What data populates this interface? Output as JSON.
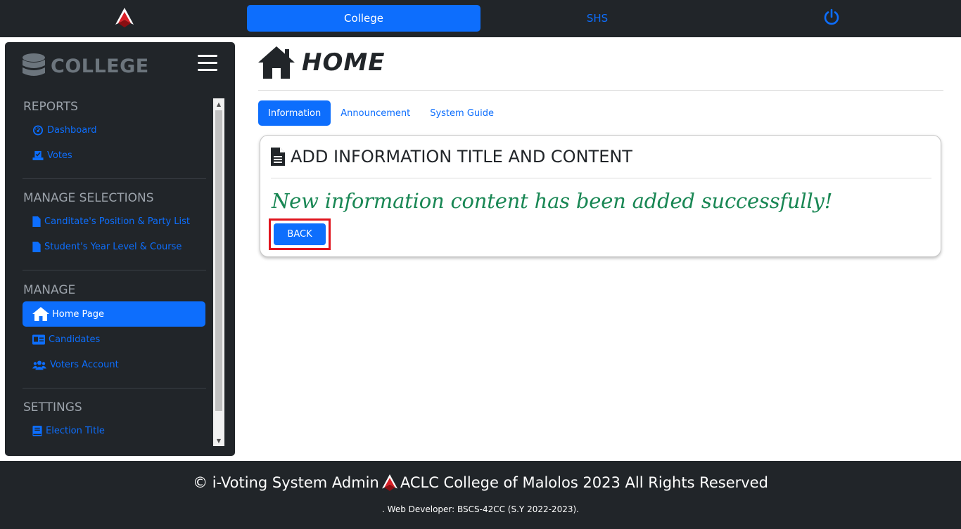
{
  "topnav": {
    "college_label": "College",
    "shs_label": "SHS"
  },
  "sidebar": {
    "brand": "COLLEGE",
    "sections": [
      {
        "title": "REPORTS",
        "items": [
          "Dashboard",
          "Votes"
        ]
      },
      {
        "title": "MANAGE SELECTIONS",
        "items": [
          "Canditate's Position & Party List",
          "Student's Year Level & Course"
        ]
      },
      {
        "title": "MANAGE",
        "items": [
          "Home Page",
          "Candidates",
          "Voters Account"
        ]
      },
      {
        "title": "SETTINGS",
        "items": [
          "Election Title"
        ]
      }
    ]
  },
  "main": {
    "title": "HOME",
    "tabs": [
      "Information",
      "Announcement",
      "System Guide"
    ],
    "active_tab": "Information",
    "card": {
      "heading": "ADD INFORMATION TITLE AND CONTENT",
      "message": "New information content has been added successfully!",
      "back_label": "BACK"
    }
  },
  "footer": {
    "left": "© i-Voting System Admin",
    "right": "ACLC College of Malolos 2023 All Rights Reserved",
    "sub": ". Web Developer: BSCS-42CC (S.Y 2022-2023)."
  },
  "colors": {
    "primary": "#0d6efd",
    "dark": "#212529",
    "success": "#198754",
    "highlight": "#e0141e"
  }
}
